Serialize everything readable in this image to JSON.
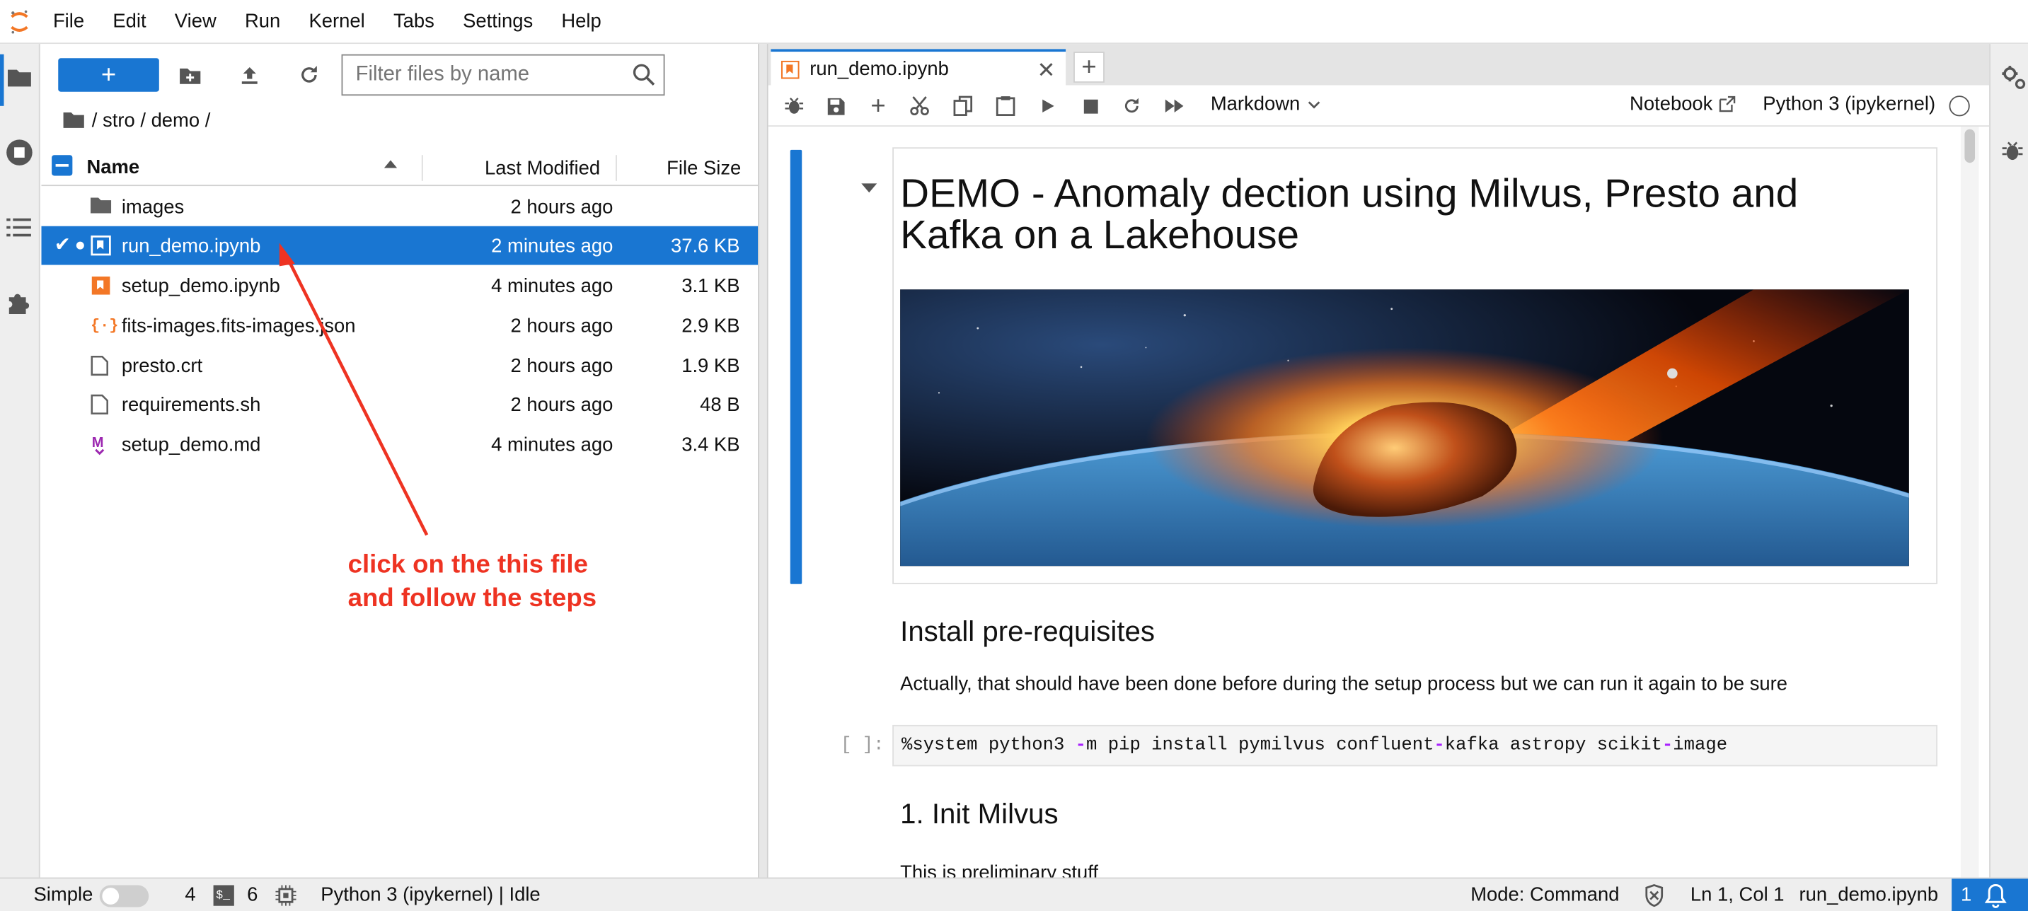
{
  "menubar": {
    "items": [
      "File",
      "Edit",
      "View",
      "Run",
      "Kernel",
      "Tabs",
      "Settings",
      "Help"
    ]
  },
  "filebrowser": {
    "new_button_label": "+",
    "filter_placeholder": "Filter files by name",
    "breadcrumb": "/ stro / demo /",
    "columns": {
      "name": "Name",
      "modified": "Last Modified",
      "size": "File Size"
    },
    "files": [
      {
        "name": "images",
        "modified": "2 hours ago",
        "size": "",
        "icon": "folder-icon"
      },
      {
        "name": "run_demo.ipynb",
        "modified": "2 minutes ago",
        "size": "37.6 KB",
        "icon": "notebook-icon",
        "selected": true
      },
      {
        "name": "setup_demo.ipynb",
        "modified": "4 minutes ago",
        "size": "3.1 KB",
        "icon": "notebook-icon"
      },
      {
        "name": "fits-images.fits-images.json",
        "modified": "2 hours ago",
        "size": "2.9 KB",
        "icon": "json-icon"
      },
      {
        "name": "presto.crt",
        "modified": "2 hours ago",
        "size": "1.9 KB",
        "icon": "file-icon"
      },
      {
        "name": "requirements.sh",
        "modified": "2 hours ago",
        "size": "48 B",
        "icon": "file-icon"
      },
      {
        "name": "setup_demo.md",
        "modified": "4 minutes ago",
        "size": "3.4 KB",
        "icon": "markdown-icon"
      }
    ]
  },
  "annotation": {
    "line1": "click on the this file",
    "line2": "and follow the steps",
    "color": "#ee3322"
  },
  "notebook": {
    "tab_title": "run_demo.ipynb",
    "cell_type": "Markdown",
    "notebook_link": "Notebook",
    "kernel_name": "Python 3 (ipykernel)",
    "title": "DEMO - Anomaly dection using Milvus, Presto and Kafka on a Lakehouse",
    "section1": "Install pre-requisites",
    "para1": "Actually, that should have been done before during the setup process but we can run it again to be sure",
    "prompt": "[ ]:",
    "code_parts": [
      "%system python3 ",
      "-",
      "m pip install pymilvus confluent",
      "-",
      "kafka astropy scikit",
      "-",
      "image"
    ],
    "section2": "1. Init Milvus",
    "para2_partial": "This is preliminary stuff"
  },
  "statusbar": {
    "mode_label": "Simple",
    "count1": "4",
    "count2": "6",
    "kernel_status": "Python 3 (ipykernel) | Idle",
    "mode": "Mode: Command",
    "cursor": "Ln 1, Col 1",
    "filename": "run_demo.ipynb",
    "notifications": "1"
  },
  "colors": {
    "accent": "#1976d2",
    "notebook_orange": "#f37726",
    "markdown_purple": "#9c27b0"
  }
}
